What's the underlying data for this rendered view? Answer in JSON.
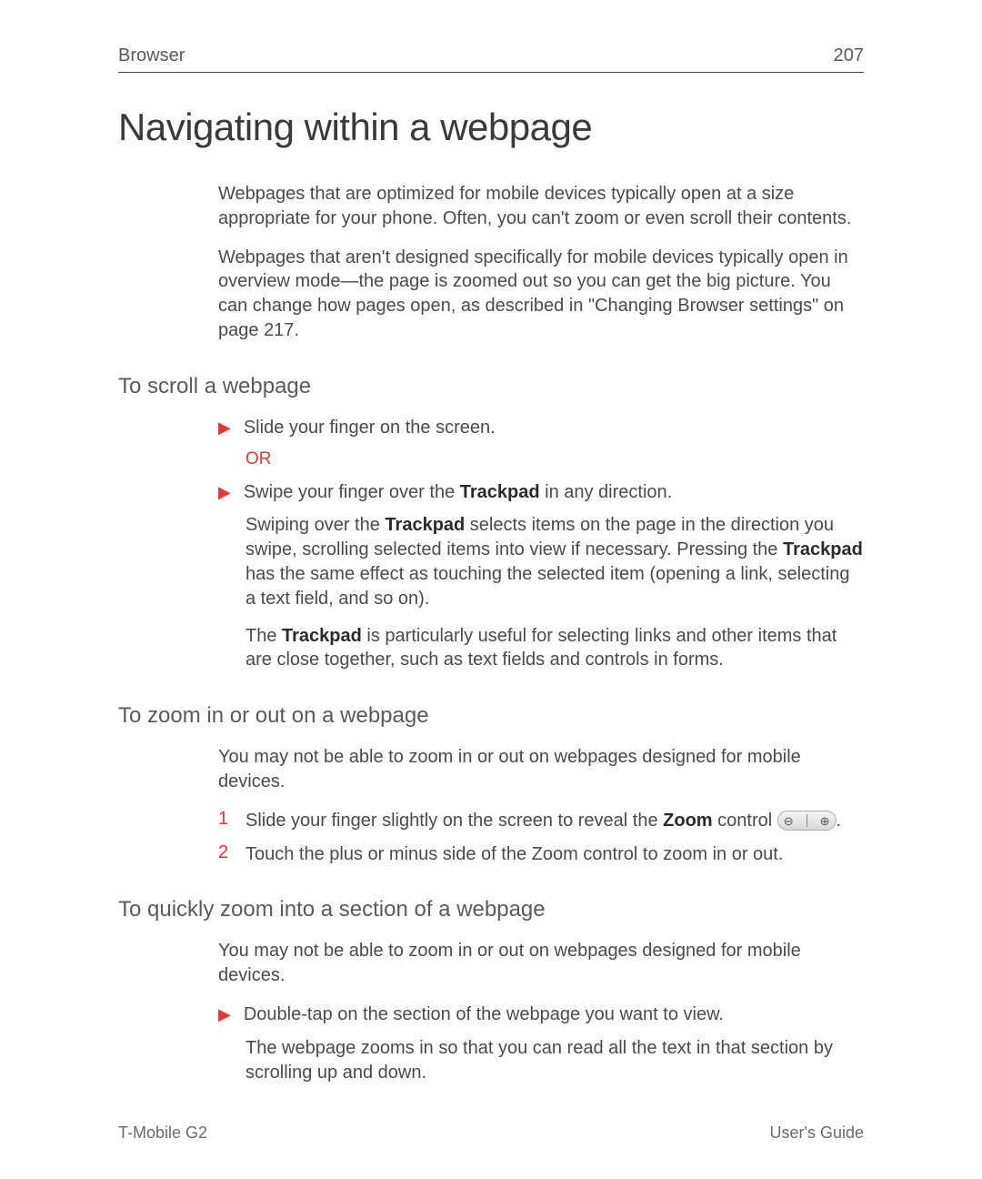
{
  "header": {
    "section": "Browser",
    "page_number": "207"
  },
  "title": "Navigating within a webpage",
  "intro": {
    "p1": "Webpages that are optimized for mobile devices typically open at a size appropriate for your phone. Often, you can't zoom or even scroll their contents.",
    "p2_a": "Webpages that aren't designed specifically for mobile devices typically open in overview mode—the page is zoomed out so you can get the big picture. You can change how pages open, as described in \"Changing Browser settings\" on page",
    "p2_pg": "217",
    "p2_b": "."
  },
  "sections": {
    "scroll": {
      "heading": "To scroll a webpage",
      "b1": "Slide your finger on the screen.",
      "or": "OR",
      "b2_a": "Swipe your finger over the ",
      "b2_tp": "Trackpad",
      "b2_b": " in any direction.",
      "p3_a": "Swiping over the ",
      "p3_tp": "Trackpad",
      "p3_b": " selects items on the page in the direction you swipe, scrolling selected items into view if necessary. Pressing the ",
      "p3_tp2": "Trackpad",
      "p3_c": " has the same effect as touching the selected item (opening a link, selecting a text field, and so on).",
      "p4_a": "The ",
      "p4_tp": "Trackpad",
      "p4_b": " is particularly useful for selecting links and other items that are close together, such as text fields and controls in forms."
    },
    "zoom": {
      "heading": "To zoom in or out on a webpage",
      "p1": "You may not be able to zoom in or out on webpages designed for mobile devices.",
      "n1_a": "Slide your finger slightly on the screen to reveal the ",
      "n1_zoom": "Zoom",
      "n1_b": " control ",
      "n1_c": ".",
      "n2": "Touch the plus or minus side of the Zoom control to zoom in or out."
    },
    "quick": {
      "heading": "To quickly zoom into a section of a webpage",
      "p1": "You may not be able to zoom in or out on webpages designed for mobile devices.",
      "b1": "Double-tap on the section of the webpage you want to view.",
      "p2": "The webpage zooms in so that you can read all the text in that section by scrolling up and down."
    }
  },
  "footer": {
    "left": "T-Mobile G2",
    "right": "User's Guide"
  },
  "numbers": {
    "one": "1",
    "two": "2"
  }
}
